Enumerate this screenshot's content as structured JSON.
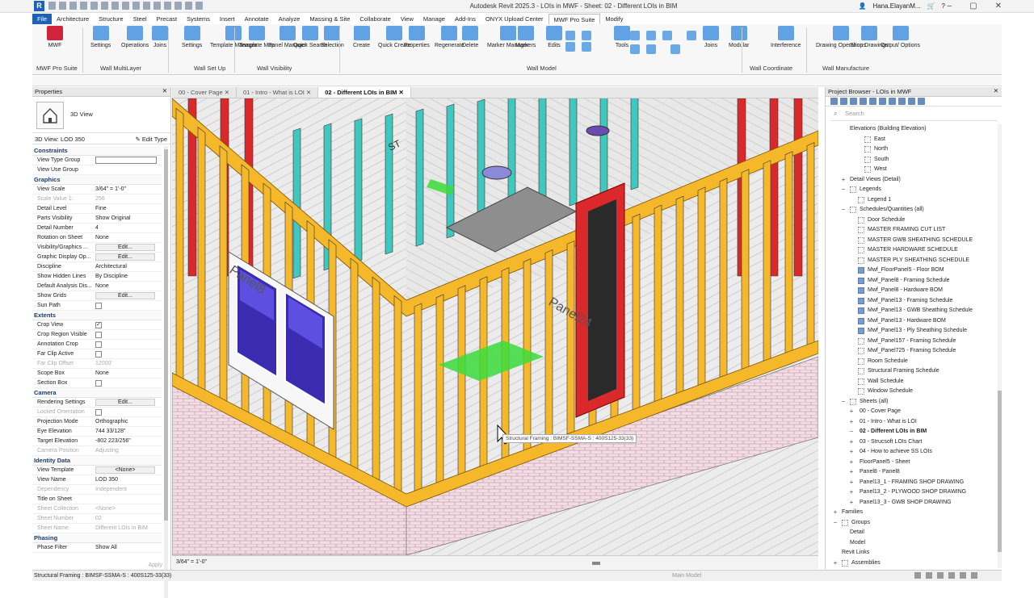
{
  "window": {
    "app_title": "Autodesk Revit 2025.3 - LOIs in MWF - Sheet: 02 - Different LOIs in BIM",
    "user": "Hana.ElayanM..."
  },
  "tabs": [
    "File",
    "Architecture",
    "Structure",
    "Steel",
    "Precast",
    "Systems",
    "Insert",
    "Annotate",
    "Analyze",
    "Massing & Site",
    "Collaborate",
    "View",
    "Manage",
    "Add-Ins",
    "ONYX Upload Center",
    "MWF Pro Suite",
    "Modify"
  ],
  "ribbon": {
    "buttons": [
      "MWF",
      "Settings",
      "Operations",
      "Joins",
      "Settings",
      "Template Manager",
      "Template Map",
      "Panel Manager",
      "Quick Search",
      "Selection",
      "Create",
      "Quick Create",
      "Properties",
      "Regenerate",
      "Delete",
      "Marker Manager",
      "Markers",
      "Edits",
      "Tools",
      "Joins",
      "Modular",
      "Interference",
      "Drawing Operations",
      "Shop Drawings",
      "Output/ Options"
    ],
    "panels": [
      "MWF Pro Suite",
      "Wall MultiLayer",
      "Wall Set Up",
      "Wall Visibility",
      "Wall Model",
      "Wall Coordinate",
      "Wall Manufacture"
    ]
  },
  "properties": {
    "title": "Properties",
    "type_name": "3D View",
    "filter": "3D View: LOD 350",
    "edit_type": "Edit Type",
    "groups": [
      {
        "name": "Constraints",
        "rows": [
          [
            "View Type Group",
            ""
          ],
          [
            "View Use Group",
            ""
          ]
        ]
      },
      {
        "name": "Graphics",
        "rows": [
          [
            "View Scale",
            "3/64\" = 1'-0\""
          ],
          [
            "Scale Value    1:",
            "256"
          ],
          [
            "Detail Level",
            "Fine"
          ],
          [
            "Parts Visibility",
            "Show Original"
          ],
          [
            "Detail Number",
            "4"
          ],
          [
            "Rotation on Sheet",
            "None"
          ],
          [
            "Visibility/Graphics ...",
            "Edit..."
          ],
          [
            "Graphic Display Op...",
            "Edit..."
          ],
          [
            "Discipline",
            "Architectural"
          ],
          [
            "Show Hidden Lines",
            "By Discipline"
          ],
          [
            "Default Analysis Dis...",
            "None"
          ],
          [
            "Show Grids",
            "Edit..."
          ],
          [
            "Sun Path",
            ""
          ]
        ]
      },
      {
        "name": "Extents",
        "rows": [
          [
            "Crop View",
            "✓"
          ],
          [
            "Crop Region Visible",
            ""
          ],
          [
            "Annotation Crop",
            ""
          ],
          [
            "Far Clip Active",
            ""
          ],
          [
            "Far Clip Offset",
            "12000'"
          ],
          [
            "Scope Box",
            "None"
          ],
          [
            "Section Box",
            ""
          ]
        ]
      },
      {
        "name": "Camera",
        "rows": [
          [
            "Rendering Settings",
            "Edit..."
          ],
          [
            "Locked Orientation",
            ""
          ],
          [
            "Projection Mode",
            "Orthographic"
          ],
          [
            "Eye Elevation",
            "744 33/128\""
          ],
          [
            "Target Elevation",
            "-802 223/256\""
          ],
          [
            "Camera Position",
            "Adjusting"
          ]
        ]
      },
      {
        "name": "Identity Data",
        "rows": [
          [
            "View Template",
            "<None>"
          ],
          [
            "View Name",
            "LOD 350"
          ],
          [
            "Dependency",
            "Independent"
          ],
          [
            "Title on Sheet",
            ""
          ],
          [
            "Sheet Collection",
            "<None>"
          ],
          [
            "Sheet Number",
            "02"
          ],
          [
            "Sheet Name",
            "Different LOIs in BIM"
          ]
        ]
      },
      {
        "name": "Phasing",
        "rows": [
          [
            "Phase Filter",
            "Show All"
          ]
        ]
      }
    ],
    "apply": "Apply"
  },
  "view_tabs": [
    "00 - Cover Page",
    "01 - Intro - What is LOI",
    "02 - Different LOIs in BIM"
  ],
  "viewbar": {
    "scale": "3/64\" = 1'-0\""
  },
  "tooltip": "Structural Framing : BIMSF-SSMA-S : 400S125-33(33)",
  "canvas_labels": [
    "ST",
    "Panel8",
    "Panel24"
  ],
  "browser": {
    "title": "Project Browser - LOIs in MWF",
    "search_placeholder": "Search",
    "items": [
      {
        "label": "Elevations (Building Elevation)",
        "level": 1,
        "exp": "",
        "ico": ""
      },
      {
        "label": "East",
        "level": 3,
        "exp": "",
        "ico": "view"
      },
      {
        "label": "North",
        "level": 3,
        "exp": "",
        "ico": "view"
      },
      {
        "label": "South",
        "level": 3,
        "exp": "",
        "ico": "view"
      },
      {
        "label": "West",
        "level": 3,
        "exp": "",
        "ico": "view"
      },
      {
        "label": "Detail Views (Detail)",
        "level": 1,
        "exp": "+",
        "ico": ""
      },
      {
        "label": "Legends",
        "level": 1,
        "exp": "−",
        "ico": "view"
      },
      {
        "label": "Legend 1",
        "level": 2,
        "exp": "",
        "ico": "view"
      },
      {
        "label": "Schedules/Quantities (all)",
        "level": 1,
        "exp": "−",
        "ico": "view"
      },
      {
        "label": "Door Schedule",
        "level": 2,
        "exp": "",
        "ico": "view"
      },
      {
        "label": "MASTER FRAMING CUT LIST",
        "level": 2,
        "exp": "",
        "ico": "view"
      },
      {
        "label": "MASTER GWB SHEATHING SCHEDULE",
        "level": 2,
        "exp": "",
        "ico": "view"
      },
      {
        "label": "MASTER HARDWARE SCHEDULE",
        "level": 2,
        "exp": "",
        "ico": "view"
      },
      {
        "label": "MASTER PLY SHEATHING SCHEDULE",
        "level": 2,
        "exp": "",
        "ico": "view"
      },
      {
        "label": "Mwf_FloorPanel5 - Floor BOM",
        "level": 2,
        "exp": "",
        "ico": "sched"
      },
      {
        "label": "Mwf_Panel8 - Framing Schedule",
        "level": 2,
        "exp": "",
        "ico": "sched"
      },
      {
        "label": "Mwf_Panel8 - Hardware BOM",
        "level": 2,
        "exp": "",
        "ico": "sched"
      },
      {
        "label": "Mwf_Panel13 - Framing Schedule",
        "level": 2,
        "exp": "",
        "ico": "sched"
      },
      {
        "label": "Mwf_Panel13 - GWB Sheathing Schedule",
        "level": 2,
        "exp": "",
        "ico": "sched"
      },
      {
        "label": "Mwf_Panel13 - Hardware BOM",
        "level": 2,
        "exp": "",
        "ico": "sched"
      },
      {
        "label": "Mwf_Panel13 - Ply Sheathing Schedule",
        "level": 2,
        "exp": "",
        "ico": "sched"
      },
      {
        "label": "Mwf_Panel157 - Framing Schedule",
        "level": 2,
        "exp": "",
        "ico": "view"
      },
      {
        "label": "Mwf_Panel725 - Framing Schedule",
        "level": 2,
        "exp": "",
        "ico": "view"
      },
      {
        "label": "Room Schedule",
        "level": 2,
        "exp": "",
        "ico": "view"
      },
      {
        "label": "Structural Framing Schedule",
        "level": 2,
        "exp": "",
        "ico": "view"
      },
      {
        "label": "Wall Schedule",
        "level": 2,
        "exp": "",
        "ico": "view"
      },
      {
        "label": "Window Schedule",
        "level": 2,
        "exp": "",
        "ico": "view"
      },
      {
        "label": "Sheets (all)",
        "level": 1,
        "exp": "−",
        "ico": "view"
      },
      {
        "label": "00 - Cover Page",
        "level": 2,
        "exp": "+",
        "ico": ""
      },
      {
        "label": "01 - Intro - What is LOI",
        "level": 2,
        "exp": "+",
        "ico": ""
      },
      {
        "label": "02 - Different LOIs in BIM",
        "level": 2,
        "exp": "−",
        "ico": "",
        "bold": true
      },
      {
        "label": "03 - Strucsoft LOIs Chart",
        "level": 2,
        "exp": "+",
        "ico": ""
      },
      {
        "label": "04 - How to achieve SS LOIs",
        "level": 2,
        "exp": "+",
        "ico": ""
      },
      {
        "label": "FloorPanel5 - Sheet",
        "level": 2,
        "exp": "+",
        "ico": ""
      },
      {
        "label": "Panel8 - Panel8",
        "level": 2,
        "exp": "+",
        "ico": ""
      },
      {
        "label": "Panel13_1 - FRAMING SHOP DRAWING",
        "level": 2,
        "exp": "+",
        "ico": ""
      },
      {
        "label": "Panel13_2 - PLYWOOD SHOP DRAWING",
        "level": 2,
        "exp": "+",
        "ico": ""
      },
      {
        "label": "Panel13_3 - GWB SHOP DRAWING",
        "level": 2,
        "exp": "+",
        "ico": ""
      },
      {
        "label": "Families",
        "level": 0,
        "exp": "+",
        "ico": ""
      },
      {
        "label": "Groups",
        "level": 0,
        "exp": "−",
        "ico": "view"
      },
      {
        "label": "Detail",
        "level": 1,
        "exp": "",
        "ico": ""
      },
      {
        "label": "Model",
        "level": 1,
        "exp": "",
        "ico": ""
      },
      {
        "label": "Revit Links",
        "level": 0,
        "exp": "",
        "ico": ""
      },
      {
        "label": "Assemblies",
        "level": 0,
        "exp": "+",
        "ico": "view"
      }
    ]
  },
  "status": {
    "text": "Structural Framing : BIMSF-SSMA-S : 400S125-33(33)",
    "workset": "Main Model"
  }
}
